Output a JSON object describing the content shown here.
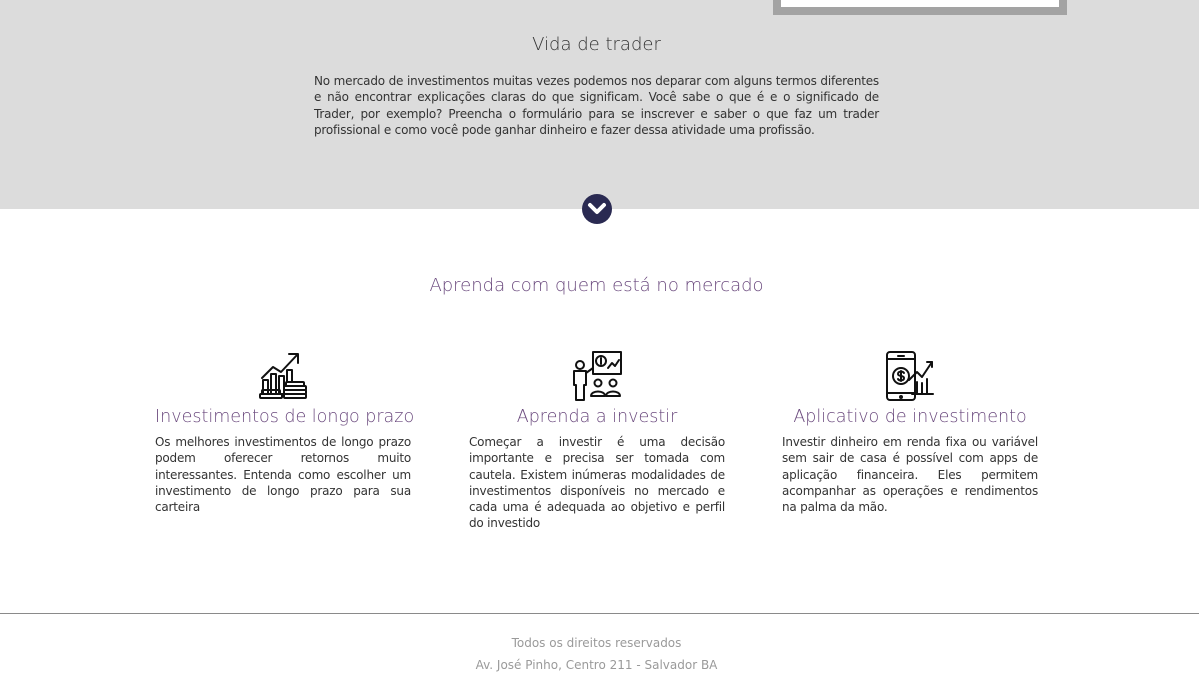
{
  "hero": {
    "title": "Vida de trader",
    "text": "No mercado de investimentos muitas vezes podemos nos deparar com alguns termos diferentes e não encontrar explicações claras do que significam. Você sabe o que é e o significado de Trader, por exemplo? Preencha o formulário para se inscrever e saber o que faz um trader profissional e como você pode ganhar dinheiro e fazer dessa atividade uma profissão."
  },
  "scroll_icon": "chevron-down-icon",
  "section": {
    "title": "Aprenda com quem está no mercado"
  },
  "features": [
    {
      "icon": "growth-chart-coins-icon",
      "title": "Investimentos de longo prazo",
      "text": "Os melhores investimentos de longo prazo podem oferecer retornos muito interessantes. Entenda como escolher um investimento de longo prazo para sua carteira"
    },
    {
      "icon": "presentation-audience-icon",
      "title": "Aprenda a investir",
      "text": "Começar a investir é uma decisão importante e precisa ser tomada com cautela. Existem inúmeras modalidades de investimentos disponíveis no mercado e cada uma é adequada ao objetivo e perfil do investido"
    },
    {
      "icon": "mobile-app-investment-icon",
      "title": "Aplicativo de investimento",
      "text": "Investir dinheiro em renda fixa ou variável sem sair de casa é possível com apps de aplicação financeira. Eles permitem acompanhar as operações e rendimentos na palma da mão."
    }
  ],
  "footer": {
    "rights": "Todos os direitos reservados",
    "address": "Av. José Pinho, Centro 211 - Salvador BA"
  },
  "colors": {
    "hero_bg": "#dcdcdc",
    "accent": "#6b4a7e",
    "button": "#2a2a52"
  }
}
